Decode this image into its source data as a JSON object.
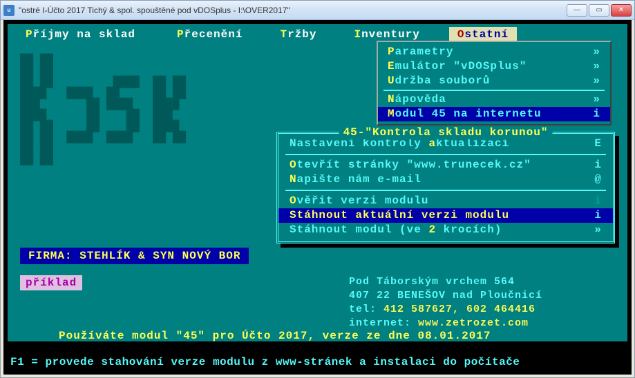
{
  "window": {
    "title": "\"ostré I-Účto 2017 Tichý & spol. spouštěné pod vDOSplus - I:\\OVER2017\""
  },
  "menu": {
    "items": [
      {
        "hot": "P",
        "label": "říjmy na sklad"
      },
      {
        "hot": "P",
        "label": "řecenění"
      },
      {
        "hot": "T",
        "label": "ržby"
      },
      {
        "hot": "I",
        "label": "nventury"
      },
      {
        "hot": "O",
        "label": "statní"
      }
    ]
  },
  "panel1": {
    "rows": [
      {
        "hot": "P",
        "label": "arametry",
        "r": "»"
      },
      {
        "hot": "E",
        "label": "mulátor \"vDOSplus\"",
        "r": "»"
      },
      {
        "hot": "U",
        "label": "držba souborů",
        "r": "»"
      },
      {
        "sep": true
      },
      {
        "hot": "N",
        "label": "ápověda",
        "r": "»"
      },
      {
        "hot": "M",
        "label": "odul 45 na internetu",
        "r": "i",
        "sel": true
      }
    ]
  },
  "panel2": {
    "title": "45-\"Kontrola skladu korunou\"",
    "rows": [
      {
        "pre": "Nastavení kontroly ",
        "hot": "a",
        "post": "ktualizací",
        "r": "E"
      },
      {
        "sep": true
      },
      {
        "hot": "O",
        "label": "tevřít stránky \"www.trunecek.cz\"",
        "r": "i"
      },
      {
        "hot": "N",
        "label": "apište nám e-mail",
        "r": "@"
      },
      {
        "sep": true
      },
      {
        "hot": "O",
        "label": "věřit verzi modulu",
        "r": "i",
        "dim": true
      },
      {
        "hot": "S",
        "label": "táhnout aktuální verzi modulu",
        "r": "i",
        "sel": true
      },
      {
        "pre": "Stáhnout modul (ve ",
        "hot": "2",
        "post": " krocích)",
        "r": "»"
      }
    ]
  },
  "firma": "FIRMA: STEHLÍK & SYN NOVÝ BOR",
  "priklad": "příklad",
  "contact": {
    "l1": "Pod Táborským vrchem 564",
    "l2": "407 22 BENEŠOV nad Ploučnicí",
    "l3a": "tel:",
    "l3b": " 412 587627, 602 464416",
    "l4a": "internet:",
    "l4b": " www.zetrozet.com"
  },
  "version": "Používáte modul \"45\" pro Účto 2017, verze ze dne 08.01.2017",
  "help": "F1 = provede stahování verze modulu z www-stránek a instalaci do počítače"
}
